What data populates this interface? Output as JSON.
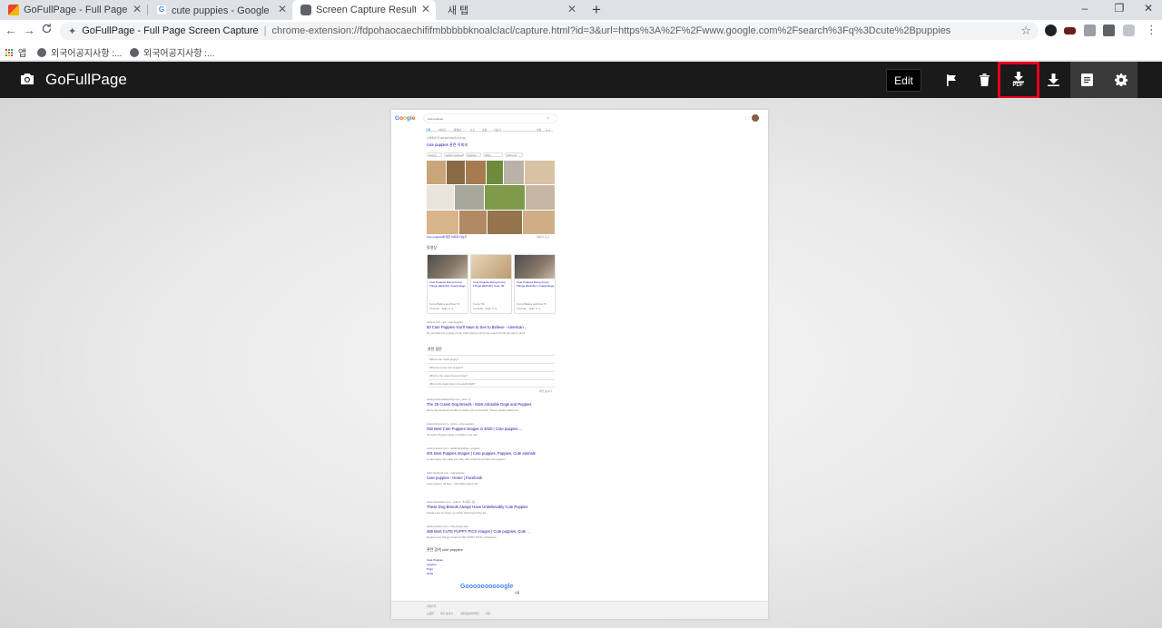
{
  "browser": {
    "tabs": [
      {
        "title": "GoFullPage - Full Page Screen C",
        "active": false
      },
      {
        "title": "cute puppies - Google 검색",
        "active": false
      },
      {
        "title": "Screen Capture Result",
        "active": true
      },
      {
        "title": "새 탭",
        "active": false
      }
    ],
    "new_tab": "+",
    "window_controls": {
      "minimize": "–",
      "restore": "❐",
      "close": "✕"
    },
    "nav": {
      "back": "←",
      "forward": "→",
      "reload": "C"
    },
    "omnibox": {
      "site_name": "GoFullPage - Full Page Screen Capture",
      "url": "chrome-extension://fdpohaocaechififmbbbbbknoalclacl/capture.html?id=3&url=https%3A%2F%2Fwww.google.com%2Fsearch%3Fq%3Dcute%2Bpuppies",
      "star": "☆"
    },
    "bookmarks": [
      {
        "label": "앱"
      },
      {
        "label": "외국어공지사항 :..."
      },
      {
        "label": "외국어공지사항 :..."
      }
    ]
  },
  "app": {
    "title": "GoFullPage",
    "edit_label": "Edit",
    "pdf_label": "PDF",
    "highlight_color": "#e8001c",
    "header_bg": "#1a1a1a"
  },
  "capture": {
    "query": "cute puppies",
    "logo": "Google",
    "tabs": [
      "전체",
      "이미지",
      "동영상",
      "뉴스",
      "쇼핑",
      "더보기",
      "설정",
      "도구"
    ],
    "result_stats": "검색결과 약 148,000,000개 (0.63초)",
    "images_heading": "cute puppies 관련 이미지",
    "chips": [
      "teacup",
      "golden retriever",
      "puppies",
      "white",
      "shiba inu"
    ],
    "more_images": "cute puppies에 대한 이미지 더보기",
    "report_images": "이미지 신고",
    "videos_heading": "동영상",
    "videos": [
      {
        "title": "Cute Puppies Doing Funny Things 2020 #4 | Cutest Dogs",
        "source": "Funny Babies and Pets TV",
        "meta": "YouTube · 2020. 2. 3."
      },
      {
        "title": "Cute Puppies Doing Funny Things 2020 #6 | Cute YR",
        "source": "Funny TM",
        "meta": "YouTube · 2020. 3. 9."
      },
      {
        "title": "Cute Puppies Doing Funny Things 2020 #11 | Cutest Dogs",
        "source": "Funny Babies and Pets TV",
        "meta": "YouTube · 2020. 5. 6."
      }
    ],
    "results": [
      {
        "cite": "www.rd.com › list › cute-puppies",
        "title": "50 Cute Puppies You'll Have to See to Believe - American ...",
        "snippet": "Do you think every puppy is the cutest puppy you've ever seen? So do we! Here's proof."
      },
      {
        "cite": "www.goodhousekeeping.com › pets › g...",
        "title": "The 25 Cutest Dog Breeds - Most Adorable Dogs and Puppies",
        "snippet": "Every dog deserves the title of 'cutest pup on the block.' These puppies stand out."
      },
      {
        "cite": "www.pinterest.com › topics › cute-puppies",
        "title": "250 Best Cute Puppies images in 2020 | Cute puppies ...",
        "snippet": "32 Cutest Puppies ideas to brighten your day."
      },
      {
        "cite": "www.pinterest.com › randomlyaddicts › puppies",
        "title": "401 Best Puppies images | Cute puppies, Puppies, Cute animals",
        "snippet": "A cute puppy can make your day, take a look at our best cute puppies."
      },
      {
        "cite": "www.facebook.com › cutepuppies",
        "title": "Cute puppies - Home | Facebook",
        "snippet": "Cute puppies. 36 likes · 192 talking about this."
      },
      {
        "cite": "www.cheatsheet.com › culture › 5-짜증 나는...",
        "title": "These Dog Breeds Always Have Unbelievably Cute Puppies",
        "snippet": "Puppies are so sweet, no matter what breed they are."
      },
      {
        "cite": "www.pinterest.com › cute-puppy-pics",
        "title": "468 Best CUTE PUPPY PICS images | Cute puppies, Cute ...",
        "snippet": "Explore Cute Puppy's board CUTE PUPPY PICS on Pinterest."
      }
    ],
    "paa_heading": "관련 질문",
    "paa": [
      "What is the cutest puppy?",
      "What are some cute puppies?",
      "Which is the cutest breed of dog?",
      "Who is the cutest dog in the world 2020?"
    ],
    "paa_feedback": "의견 보내기",
    "related_heading": "관련 검색",
    "related_query": "cute puppies",
    "related": [
      "Cute Puppies",
      "puppies",
      "Pugs",
      "shiba"
    ],
    "pagination_logo": "Goooooooooogle",
    "pagination_next": "다음",
    "footer_location": "대한민국",
    "footer_links": [
      "도움말",
      "의견 보내기",
      "개인정보처리방침",
      "약관"
    ]
  }
}
